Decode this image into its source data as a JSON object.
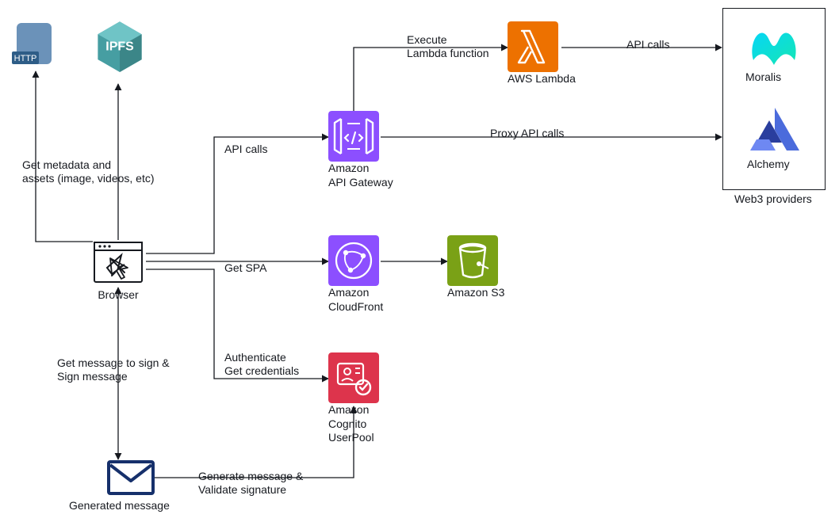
{
  "nodes": {
    "http": {
      "label": ""
    },
    "ipfs": {
      "label": "IPFS"
    },
    "browser": {
      "label": "Browser"
    },
    "api_gateway": {
      "label": "Amazon\nAPI Gateway"
    },
    "cloudfront": {
      "label": "Amazon\nCloudFront"
    },
    "s3": {
      "label": "Amazon S3"
    },
    "cognito": {
      "label": "Amazon\nCognito\nUserPool"
    },
    "lambda": {
      "label": "AWS Lambda"
    },
    "moralis": {
      "label": "Moralis"
    },
    "alchemy": {
      "label": "Alchemy"
    },
    "web3_group": {
      "label": "Web3 providers"
    },
    "message": {
      "label": "Generated message"
    }
  },
  "edges": {
    "browser_to_http_ipfs": "Get metadata and\nassets (image, videos, etc)",
    "browser_api_calls": "API calls",
    "apigw_lambda": "Execute\nLambda function",
    "lambda_providers": "API calls",
    "apigw_proxy": "Proxy API calls",
    "browser_spa": "Get SPA",
    "browser_cognito": "Authenticate\nGet credentials",
    "browser_message": "Get message to sign &\nSign message",
    "cognito_message": "Generate message &\nValidate signature"
  },
  "chart_data": {
    "type": "diagram",
    "nodes": [
      {
        "id": "http",
        "label": "HTTP",
        "kind": "protocol-http"
      },
      {
        "id": "ipfs",
        "label": "IPFS",
        "kind": "protocol-ipfs"
      },
      {
        "id": "browser",
        "label": "Browser",
        "kind": "client"
      },
      {
        "id": "api_gateway",
        "label": "Amazon API Gateway",
        "kind": "aws-service"
      },
      {
        "id": "cloudfront",
        "label": "Amazon CloudFront",
        "kind": "aws-service"
      },
      {
        "id": "s3",
        "label": "Amazon S3",
        "kind": "aws-service"
      },
      {
        "id": "cognito",
        "label": "Amazon Cognito UserPool",
        "kind": "aws-service"
      },
      {
        "id": "lambda",
        "label": "AWS Lambda",
        "kind": "aws-service"
      },
      {
        "id": "moralis",
        "label": "Moralis",
        "kind": "web3-provider"
      },
      {
        "id": "alchemy",
        "label": "Alchemy",
        "kind": "web3-provider"
      },
      {
        "id": "message",
        "label": "Generated message",
        "kind": "artifact"
      }
    ],
    "groups": [
      {
        "id": "web3_providers",
        "label": "Web3 providers",
        "members": [
          "moralis",
          "alchemy"
        ]
      }
    ],
    "edges": [
      {
        "from": "browser",
        "to": "http",
        "label": "Get metadata and assets (image, videos, etc)"
      },
      {
        "from": "browser",
        "to": "ipfs",
        "label": "Get metadata and assets (image, videos, etc)"
      },
      {
        "from": "browser",
        "to": "api_gateway",
        "label": "API calls"
      },
      {
        "from": "api_gateway",
        "to": "lambda",
        "label": "Execute Lambda function"
      },
      {
        "from": "lambda",
        "to": "moralis",
        "label": "API calls"
      },
      {
        "from": "lambda",
        "to": "alchemy",
        "label": "API calls"
      },
      {
        "from": "api_gateway",
        "to": "moralis",
        "label": "Proxy API calls"
      },
      {
        "from": "api_gateway",
        "to": "alchemy",
        "label": "Proxy API calls"
      },
      {
        "from": "browser",
        "to": "cloudfront",
        "label": "Get SPA"
      },
      {
        "from": "cloudfront",
        "to": "s3",
        "label": ""
      },
      {
        "from": "browser",
        "to": "cognito",
        "label": "Authenticate Get credentials"
      },
      {
        "from": "browser",
        "to": "message",
        "label": "Get message to sign & Sign message",
        "bidirectional": true
      },
      {
        "from": "cognito",
        "to": "message",
        "label": "Generate message & Validate signature",
        "bidirectional": true
      }
    ]
  }
}
